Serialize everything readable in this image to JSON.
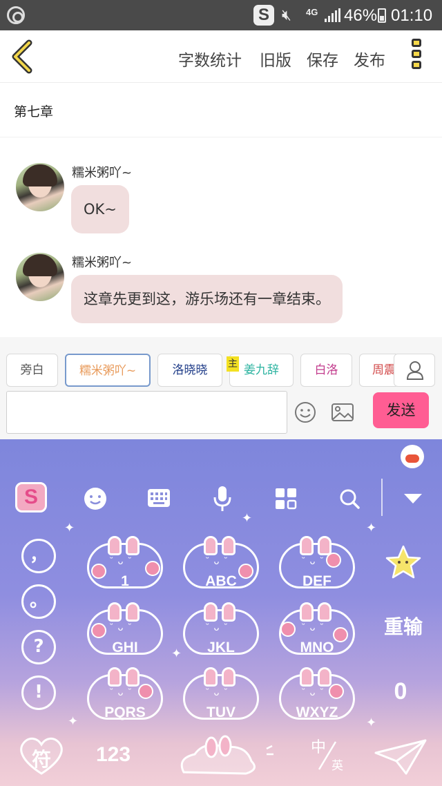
{
  "status_bar": {
    "battery_percent": "46%",
    "time": "01:10",
    "network": "4G",
    "app_icon_letter": "S"
  },
  "top_bar": {
    "actions": [
      "字数统计",
      "旧版",
      "保存",
      "发布"
    ]
  },
  "chapter": {
    "title": "第七章"
  },
  "messages": [
    {
      "sender": "糯米粥吖~",
      "text": "OK~"
    },
    {
      "sender": "糯米粥吖~",
      "text": "这章先更到这，游乐场还有一章结束。"
    }
  ],
  "roles": {
    "chips": [
      "旁白",
      "糯米粥吖~",
      "洛晓晓",
      "姜九辞",
      "白洛",
      "周震"
    ],
    "chip_colors": [
      "#555555",
      "#e89a5a",
      "#1f3c88",
      "#2bb3a0",
      "#c23a8c",
      "#d24a4a"
    ],
    "selected_index": 1,
    "host_badge": "主"
  },
  "composer": {
    "send_label": "发送",
    "input_value": ""
  },
  "keyboard": {
    "logo_letter": "S",
    "punctuation": [
      "，",
      "。",
      "?",
      "!"
    ],
    "keys": [
      "1",
      "ABC",
      "DEF",
      "GHI",
      "JKL",
      "MNO",
      "PQRS",
      "TUV",
      "WXYZ"
    ],
    "right_keys": {
      "reenter": "重输",
      "zero": "0"
    },
    "bottom": {
      "symbol": "符",
      "number": "123",
      "lang_top": "中",
      "lang_bottom": "英"
    }
  }
}
